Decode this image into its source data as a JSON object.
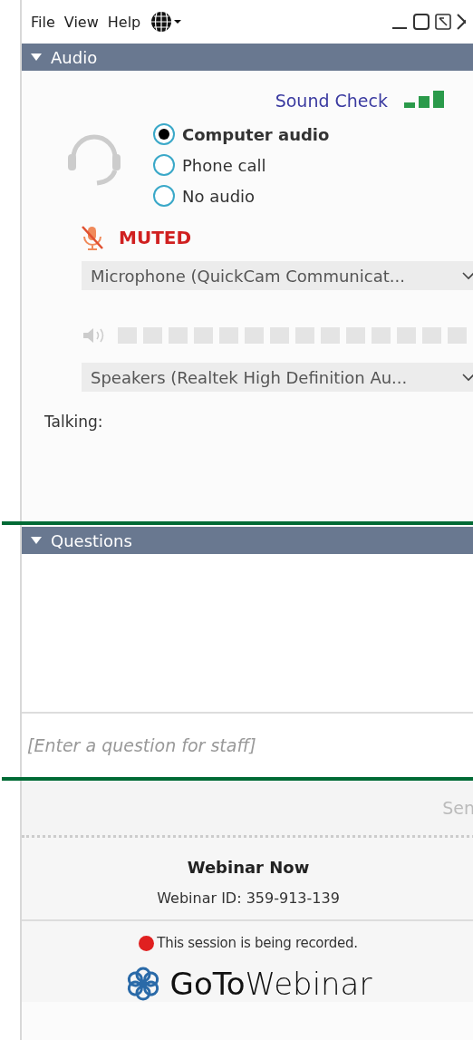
{
  "menu": [
    "File",
    "View",
    "Help"
  ],
  "audio": {
    "title": "Audio",
    "expanded": true,
    "sound_check": "Sound Check",
    "options": [
      {
        "label": "Computer audio",
        "selected": true
      },
      {
        "label": "Phone call",
        "selected": false
      },
      {
        "label": "No audio",
        "selected": false
      }
    ],
    "mic_status": "MUTED",
    "microphone": "Microphone (QuickCam Communicat...",
    "speakers": "Speakers (Realtek High Definition Au...",
    "talking": "Talking:"
  },
  "questions": {
    "title": "Questions",
    "expanded": true,
    "placeholder": "[Enter a question for staff]",
    "send": "Sen"
  },
  "footer": {
    "webinar_name": "Webinar Now",
    "webinar_id": "Webinar ID: 359-913-139",
    "recording": "This session is being recorded.",
    "logo": "**GoTo**Webinar"
  }
}
